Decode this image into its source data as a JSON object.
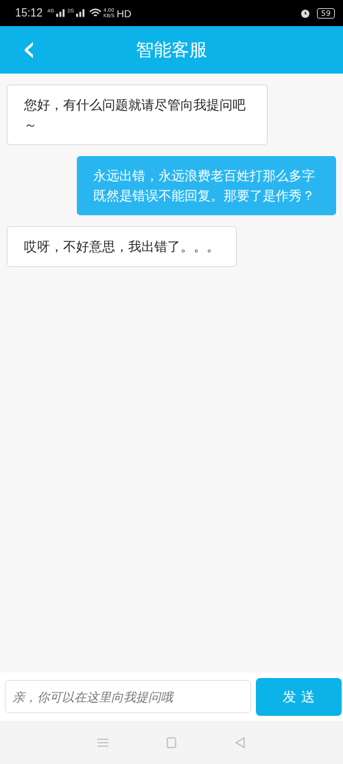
{
  "status_bar": {
    "time": "15:12",
    "sim_1": "4G",
    "sim_2": "2G",
    "speed_value": "4.00",
    "speed_unit": "KB/S",
    "hd": "HD",
    "battery": "59"
  },
  "header": {
    "back": "‹",
    "title": "智能客服"
  },
  "messages": [
    {
      "kind": "bot",
      "text": "您好，有什么问题就请尽管向我提问吧～"
    },
    {
      "kind": "user",
      "text": "永远出错，永远浪费老百姓打那么多字既然是错误不能回复。那要了是作秀？"
    },
    {
      "kind": "bot",
      "text": "哎呀，不好意思，我出错了。。。"
    }
  ],
  "input": {
    "placeholder": "亲，你可以在这里向我提问哦",
    "send": "发 送"
  }
}
